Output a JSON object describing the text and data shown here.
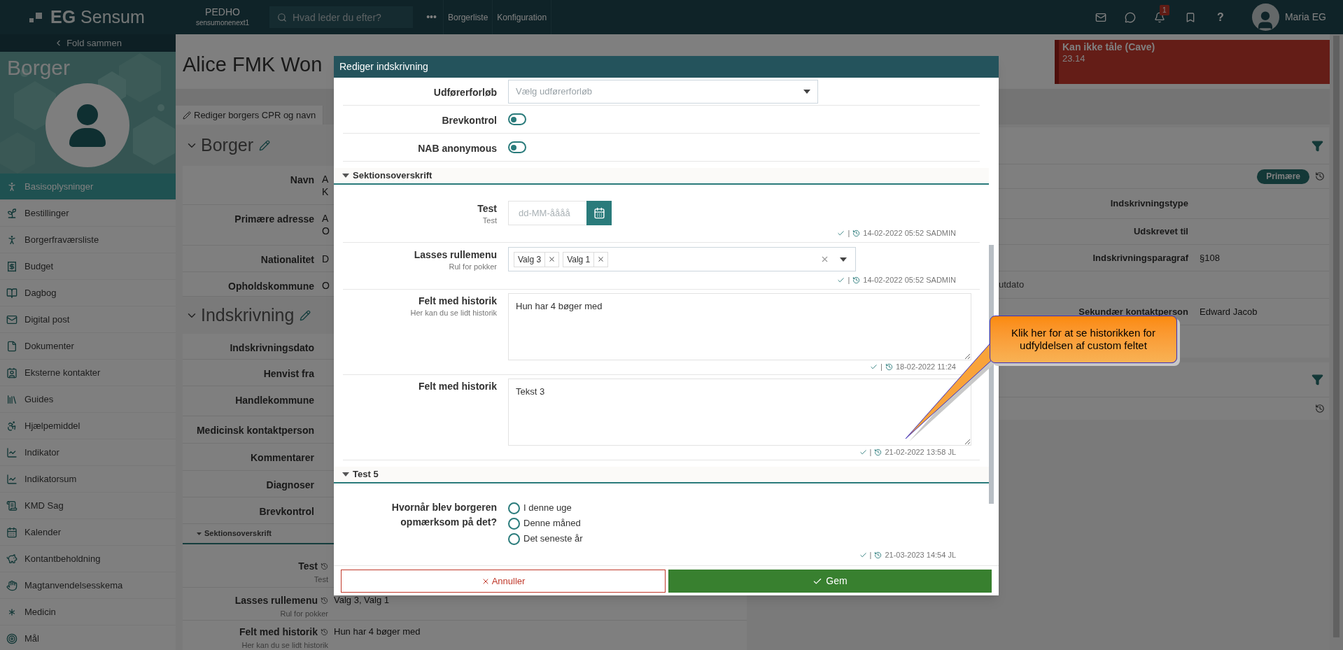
{
  "topbar": {
    "logo": "**EG** Sensum",
    "tenant": "PEDHO",
    "tenant_sub": "sensumonenext1",
    "search": {
      "placeholder": "Hvad leder du efter?"
    },
    "more": "•••",
    "links": [
      "Borgerliste",
      "Konfiguration"
    ],
    "notification_count": "1",
    "help": "?",
    "user": "Maria EG"
  },
  "sidebar": {
    "collapse": "Fold sammen",
    "title": "Borger",
    "items": [
      {
        "label": "Basisoplysninger",
        "selected": true
      },
      {
        "label": "Bestillinger",
        "selected": false
      },
      {
        "label": "Borgerfraværsliste",
        "selected": false
      },
      {
        "label": "Budget",
        "selected": false
      },
      {
        "label": "Dagbog",
        "selected": false
      },
      {
        "label": "Digital post",
        "selected": false
      },
      {
        "label": "Dokumenter",
        "selected": false
      },
      {
        "label": "Eksterne kontakter",
        "selected": false
      },
      {
        "label": "Guides",
        "selected": false
      },
      {
        "label": "Hjælpemiddel",
        "selected": false
      },
      {
        "label": "Indikator",
        "selected": false
      },
      {
        "label": "Indikatorsum",
        "selected": false
      },
      {
        "label": "KMD Sag",
        "selected": false
      },
      {
        "label": "Kalender",
        "selected": false
      },
      {
        "label": "Kontantbeholdning",
        "selected": false
      },
      {
        "label": "Magtanvendelsesskema",
        "selected": false
      },
      {
        "label": "Medicin",
        "selected": false
      },
      {
        "label": "Mål",
        "selected": false
      }
    ]
  },
  "page": {
    "title": "Alice FMK Won",
    "edit_link": "Rediger borgers CPR og navn",
    "borger": {
      "heading": "Borger",
      "rows": [
        {
          "label": "Navn",
          "value": [
            "A",
            "K"
          ]
        },
        {
          "label": "Primære adresse",
          "value": [
            "A",
            "O"
          ]
        },
        {
          "label": "Nationalitet",
          "value": [
            "D"
          ]
        },
        {
          "label": "Opholdskommune",
          "value": [
            "O"
          ]
        }
      ]
    },
    "indskrivning": {
      "heading": "Indskrivning",
      "rows": [
        {
          "label": "Indskrivningsdato"
        },
        {
          "label": "Henvist fra"
        },
        {
          "label": "Handlekommune"
        },
        {
          "label": "Medicinsk kontaktperson"
        },
        {
          "label": "Kommentarer"
        },
        {
          "label": "Diagnoser"
        },
        {
          "label": "Brevkontrol"
        }
      ]
    },
    "section": {
      "heading": "Sektionsoverskrift",
      "rows": [
        {
          "label": "Test",
          "sublabel": "Test"
        },
        {
          "label": "Lasses rullemenu",
          "sublabel": "Rul for pokker",
          "value": "Valg 3, Valg 1"
        },
        {
          "label": "Felt med historik",
          "sublabel": "Her kan du se lidt historik",
          "value": "Hun har 4 bøger med"
        }
      ]
    }
  },
  "alert": {
    "title": "Kan ikke tåle (Cave)",
    "value": "23.14"
  },
  "right_panel": {
    "badge": "Primære",
    "rows": [
      {
        "label": "Indskrivningstype",
        "kind": "field"
      },
      {
        "label": "Udskrevet til",
        "kind": "field"
      },
      {
        "label": "Indskrivningsparagraf",
        "kind": "field",
        "value": "§108"
      },
      {
        "label": "utdato",
        "kind": "clipped"
      },
      {
        "label": "Sekundær kontaktperson",
        "kind": "field",
        "value": "Edward Jacob"
      }
    ]
  },
  "modal": {
    "title": "Rediger indskrivning",
    "fields": [
      {
        "kind": "select",
        "label": "Udførerforløb",
        "placeholder": "Vælg udførerforløb"
      },
      {
        "kind": "toggle",
        "label": "Brevkontrol",
        "on": false
      },
      {
        "kind": "toggle",
        "label": "NAB anonymous",
        "on": false
      },
      {
        "kind": "section",
        "label": "Sektionsoverskrift"
      },
      {
        "kind": "date",
        "label": "Test",
        "sublabel": "Test",
        "placeholder": "dd-MM-åååå",
        "meta": {
          "separator": "|",
          "stamp": "14-02-2022 05:52 SADMIN"
        }
      },
      {
        "kind": "multiselect",
        "label": "Lasses rullemenu",
        "sublabel": "Rul for pokker",
        "tags": [
          "Valg 3",
          "Valg 1"
        ],
        "meta": {
          "separator": "|",
          "stamp": "14-02-2022 05:52 SADMIN"
        }
      },
      {
        "kind": "textarea",
        "label": "Felt med historik",
        "sublabel": "Her kan du se lidt historik",
        "value": "Hun har 4 bøger med",
        "meta": {
          "separator": "|",
          "stamp": "18-02-2022 11:24"
        }
      },
      {
        "kind": "textarea",
        "label": "Felt med historik",
        "value": "Tekst 3",
        "meta": {
          "separator": "|",
          "stamp": "21-02-2022 13:58 JL"
        }
      },
      {
        "kind": "section",
        "label": "Test 5"
      },
      {
        "kind": "radio",
        "label": "Hvornår blev borgeren opmærksom på det?",
        "options": [
          {
            "label": "I denne uge",
            "selected": false
          },
          {
            "label": "Denne måned",
            "selected": false
          },
          {
            "label": "Det seneste år",
            "selected": false
          }
        ],
        "meta": {
          "separator": "|",
          "stamp": "21-03-2023 14:54 JL"
        }
      }
    ],
    "cancel": "Annuller",
    "save": "Gem"
  },
  "callout": {
    "text": "Klik her for at se historikken for udfyldelsen af custom feltet"
  }
}
